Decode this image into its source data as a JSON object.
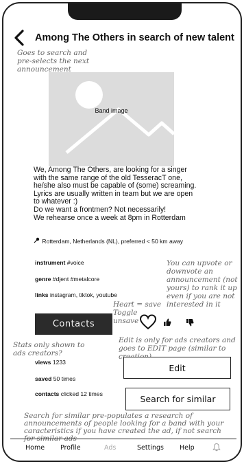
{
  "header": {
    "back_icon": "chevron-left-icon",
    "title": "Among The Others in search of new talent"
  },
  "notes": {
    "title_note": "Goes to search and pre-selects the next announcement",
    "vote_note": "You can upvote or downvote an announcement (not yours) to rank it up even if you are not interested in it",
    "heart_note": "Heart = save Toggle unsave",
    "edit_note": "Edit is only for ads creators and goes to EDIT page (similar to creation)",
    "stats_note": "Stats only shown to ads creators?",
    "search_note": "Search for similar pre-populates a research of announcements of people looking for a band with your caracteristics if you have created the ad, if not search for similar ads"
  },
  "band_image": {
    "label": "Band image",
    "icon": "image-placeholder-icon"
  },
  "description": {
    "lines": [
      "We, Among The Others, are looking for a singer",
      "with the same range of the old TesseracT one,",
      "he/she also must be capable of (some) screaming.",
      "Lyrics are usually written in team but we are open",
      "to whatever :)",
      "Do we want a frontmen? Not necessarily!",
      "We rehearse once a week at 8pm in Rotterdam"
    ]
  },
  "location": {
    "icon": "pin-icon",
    "text": "Rotterdam, Netherlands (NL), preferred < 50 km away"
  },
  "fields": {
    "instrument": {
      "label": "instrument",
      "value": "#voice"
    },
    "genre": {
      "label": "genre",
      "value": "#djent #metalcore"
    },
    "links": {
      "label": "links",
      "value": "instagram, tiktok, youtube"
    }
  },
  "actions": {
    "contacts_label": "Contacts",
    "heart_icon": "heart-icon",
    "upvote_icon": "thumbs-up-icon",
    "downvote_icon": "thumbs-down-icon",
    "edit_label": "Edit",
    "search_label": "Search for similar"
  },
  "stats": {
    "views": {
      "label": "views",
      "value": "1233"
    },
    "saved": {
      "label": "saved",
      "value": "50 times"
    },
    "contacts": {
      "label": "contacts",
      "value": "clicked 12 times"
    }
  },
  "nav": {
    "items": [
      "Home",
      "Profile",
      "Ads",
      "Settings",
      "Help"
    ],
    "bell_icon": "bell-icon"
  }
}
